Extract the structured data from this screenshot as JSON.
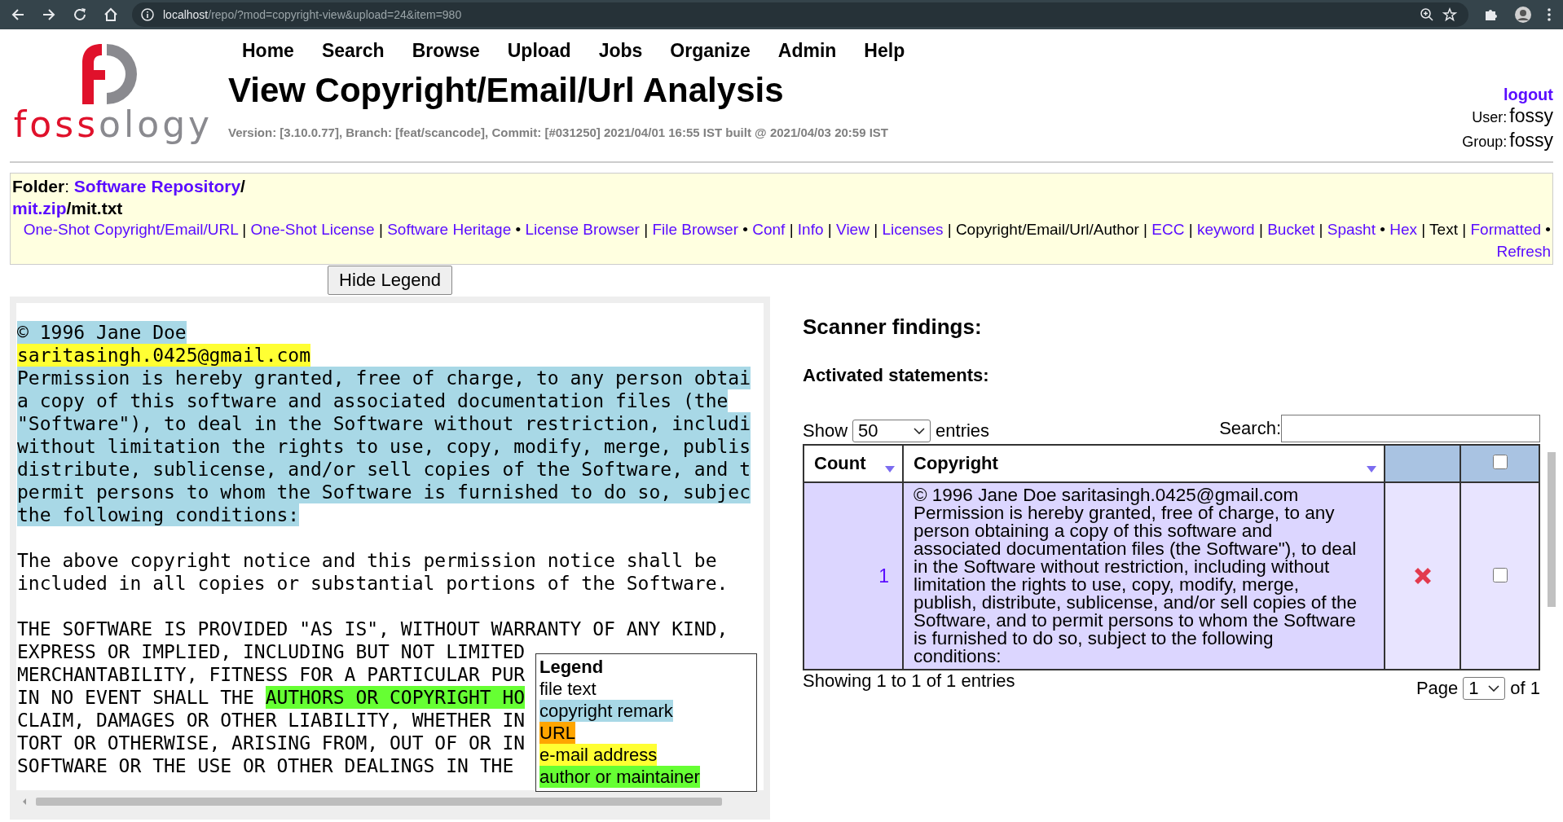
{
  "browser": {
    "url_host": "localhost",
    "url_path": "/repo/?mod=copyright-view&upload=24&item=980"
  },
  "logo": {
    "accent_text": "foss",
    "rest_text": "ology"
  },
  "nav": [
    "Home",
    "Search",
    "Browse",
    "Upload",
    "Jobs",
    "Organize",
    "Admin",
    "Help"
  ],
  "title": "View Copyright/Email/Url Analysis",
  "version": "Version: [3.10.0.77], Branch: [feat/scancode], Commit: [#031250] 2021/04/01 16:55 IST built @ 2021/04/03 20:59 IST",
  "user_box": {
    "logout": "logout",
    "user_label": "User:",
    "user": "fossy",
    "group_label": "Group:",
    "group": "fossy"
  },
  "folder": {
    "label": "Folder",
    "colon": ":",
    "folder_link": "Software Repository",
    "slash": "/",
    "upload_link": "mit.zip",
    "file": "/mit.txt"
  },
  "file_nav": [
    {
      "kind": "link",
      "label": "One-Shot Copyright/Email/URL"
    },
    {
      "kind": "sep",
      "label": "|"
    },
    {
      "kind": "link",
      "label": "One-Shot License"
    },
    {
      "kind": "sep",
      "label": "|"
    },
    {
      "kind": "link",
      "label": "Software Heritage"
    },
    {
      "kind": "sep",
      "label": "•"
    },
    {
      "kind": "link",
      "label": "License Browser"
    },
    {
      "kind": "sep",
      "label": "|"
    },
    {
      "kind": "link",
      "label": "File Browser"
    },
    {
      "kind": "sep",
      "label": "•"
    },
    {
      "kind": "link",
      "label": "Conf"
    },
    {
      "kind": "sep",
      "label": "|"
    },
    {
      "kind": "link",
      "label": "Info"
    },
    {
      "kind": "sep",
      "label": "|"
    },
    {
      "kind": "link",
      "label": "View"
    },
    {
      "kind": "sep",
      "label": "|"
    },
    {
      "kind": "link",
      "label": "Licenses"
    },
    {
      "kind": "sep",
      "label": "|"
    },
    {
      "kind": "current",
      "label": "Copyright/Email/Url/Author"
    },
    {
      "kind": "sep",
      "label": "|"
    },
    {
      "kind": "link",
      "label": "ECC"
    },
    {
      "kind": "sep",
      "label": "|"
    },
    {
      "kind": "link",
      "label": "keyword"
    },
    {
      "kind": "sep",
      "label": "|"
    },
    {
      "kind": "link",
      "label": "Bucket"
    },
    {
      "kind": "sep",
      "label": "|"
    },
    {
      "kind": "link",
      "label": "Spasht"
    },
    {
      "kind": "sep",
      "label": "•"
    },
    {
      "kind": "link",
      "label": "Hex"
    },
    {
      "kind": "sep",
      "label": "|"
    },
    {
      "kind": "current",
      "label": "Text"
    },
    {
      "kind": "sep",
      "label": "|"
    },
    {
      "kind": "link",
      "label": "Formatted"
    },
    {
      "kind": "sep",
      "label": "•"
    },
    {
      "kind": "link",
      "label": "Refresh"
    }
  ],
  "hide_legend_button": "Hide Legend",
  "file_lines": [
    {
      "kind": "text",
      "segments": [
        {
          "kind": "copyright",
          "text": "© 1996 Jane Doe"
        }
      ]
    },
    {
      "kind": "text",
      "segments": [
        {
          "kind": "email",
          "text": "saritasingh.0425@gmail.com"
        }
      ]
    },
    {
      "kind": "text",
      "segments": [
        {
          "kind": "copyright",
          "text": "Permission is hereby granted, free of charge, to any person obtai"
        }
      ]
    },
    {
      "kind": "text",
      "segments": [
        {
          "kind": "copyright",
          "text": "a copy of this software and associated documentation files (the"
        }
      ]
    },
    {
      "kind": "text",
      "segments": [
        {
          "kind": "copyright",
          "text": "\"Software\"), to deal in the Software without restriction, includi"
        }
      ]
    },
    {
      "kind": "text",
      "segments": [
        {
          "kind": "copyright",
          "text": "without limitation the rights to use, copy, modify, merge, publis"
        }
      ]
    },
    {
      "kind": "text",
      "segments": [
        {
          "kind": "copyright",
          "text": "distribute, sublicense, and/or sell copies of the Software, and t"
        }
      ]
    },
    {
      "kind": "text",
      "segments": [
        {
          "kind": "copyright",
          "text": "permit persons to whom the Software is furnished to do so, subjec"
        }
      ]
    },
    {
      "kind": "text",
      "segments": [
        {
          "kind": "copyright",
          "text": "the following conditions:"
        }
      ]
    },
    {
      "kind": "blank"
    },
    {
      "kind": "text",
      "segments": [
        {
          "kind": "plain",
          "text": "The above copyright notice and this permission notice shall be"
        }
      ]
    },
    {
      "kind": "text",
      "segments": [
        {
          "kind": "plain",
          "text": "included in all copies or substantial portions of the Software."
        }
      ]
    },
    {
      "kind": "blank"
    },
    {
      "kind": "text",
      "segments": [
        {
          "kind": "plain",
          "text": "THE SOFTWARE IS PROVIDED \"AS IS\", WITHOUT WARRANTY OF ANY KIND,"
        }
      ]
    },
    {
      "kind": "text",
      "segments": [
        {
          "kind": "plain",
          "text": "EXPRESS OR IMPLIED, INCLUDING BUT NOT LIMITED"
        }
      ]
    },
    {
      "kind": "text",
      "segments": [
        {
          "kind": "plain",
          "text": "MERCHANTABILITY, FITNESS FOR A PARTICULAR PUR"
        }
      ]
    },
    {
      "kind": "text",
      "segments": [
        {
          "kind": "plain",
          "text": "IN NO EVENT SHALL THE "
        },
        {
          "kind": "author",
          "text": "AUTHORS OR COPYRIGHT HO"
        }
      ]
    },
    {
      "kind": "text",
      "segments": [
        {
          "kind": "plain",
          "text": "CLAIM, DAMAGES OR OTHER LIABILITY, WHETHER IN"
        }
      ]
    },
    {
      "kind": "text",
      "segments": [
        {
          "kind": "plain",
          "text": "TORT OR OTHERWISE, ARISING FROM, OUT OF OR IN"
        }
      ]
    },
    {
      "kind": "text",
      "segments": [
        {
          "kind": "plain",
          "text": "SOFTWARE OR THE USE OR OTHER DEALINGS IN THE"
        }
      ]
    }
  ],
  "legend": {
    "title": "Legend",
    "items": [
      {
        "kind": "plain",
        "label": "file text"
      },
      {
        "kind": "copyright",
        "label": "copyright remark"
      },
      {
        "kind": "url",
        "label": "URL"
      },
      {
        "kind": "email",
        "label": "e-mail address"
      },
      {
        "kind": "author",
        "label": "author or maintainer"
      }
    ]
  },
  "findings": {
    "heading": "Scanner findings:",
    "subheading": "Activated statements:",
    "show_label": "Show",
    "page_size": "50",
    "entries_label": "entries",
    "search_label": "Search:",
    "columns": [
      {
        "label": "Count"
      },
      {
        "label": "Copyright"
      }
    ],
    "select_all_checked": false,
    "rows": [
      {
        "count": "1",
        "copyright": "© 1996 Jane Doe saritasingh.0425@gmail.com Permission is hereby granted, free of charge, to any person obtaining a copy of this software and associated documentation files (the Software\"), to deal in the Software without restriction, including without limitation the rights to use, copy, modify, merge, publish, distribute, sublicense, and/or sell copies of the Software, and to permit persons to whom the Software is furnished to do so, subject to the following conditions:",
        "checked": false
      }
    ],
    "info": "Showing 1 to 1 of 1 entries",
    "page_label": "Page",
    "page": "1",
    "page_of": "of 1"
  }
}
